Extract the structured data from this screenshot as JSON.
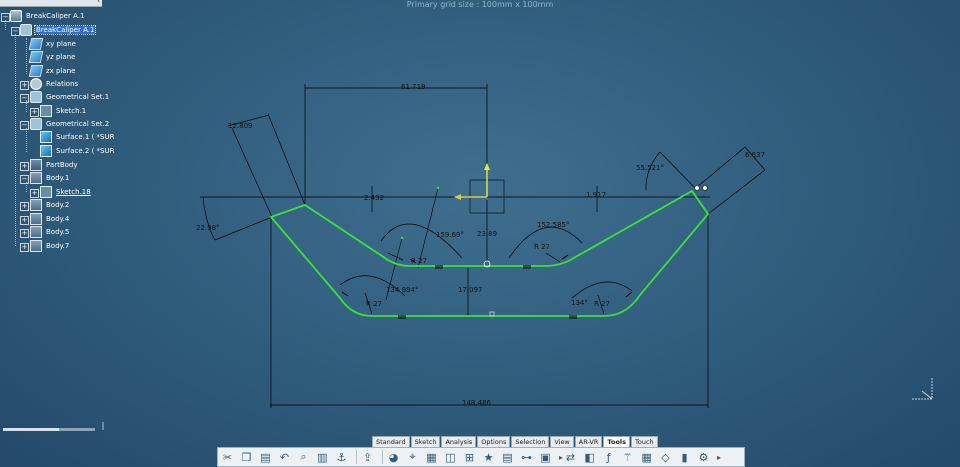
{
  "viewport": {
    "grid_size_label": "Primary grid size : 100mm x 100mm"
  },
  "tree": {
    "root": "BreakCaliper A.1",
    "part": "BreakCaliper A.1",
    "items": [
      {
        "label": "xy plane",
        "icon": "plane-icon"
      },
      {
        "label": "yz plane",
        "icon": "plane-icon"
      },
      {
        "label": "zx plane",
        "icon": "plane-icon"
      },
      {
        "label": "Relations",
        "icon": "relations-icon"
      },
      {
        "label": "Geometrical Set.1",
        "icon": "geometrical-set-icon"
      },
      {
        "label": "Sketch.1",
        "icon": "sketch-icon"
      },
      {
        "label": "Geometrical Set.2",
        "icon": "geometrical-set-icon"
      },
      {
        "label": "Surface.1 ( *SUR",
        "icon": "surface-icon"
      },
      {
        "label": "Surface.2 ( *SUR",
        "icon": "surface-icon"
      },
      {
        "label": "PartBody",
        "icon": "body-icon"
      },
      {
        "label": "Body.1",
        "icon": "body-icon"
      },
      {
        "label": "Sketch.18",
        "icon": "sketch-icon"
      },
      {
        "label": "Body.2",
        "icon": "body-icon"
      },
      {
        "label": "Body.4",
        "icon": "body-icon"
      },
      {
        "label": "Body.5",
        "icon": "body-icon"
      },
      {
        "label": "Body.7",
        "icon": "body-icon"
      }
    ]
  },
  "dimensions": {
    "d_61_719": "61.719",
    "d_12_809": "12.809",
    "d_2_432": "2.432",
    "d_22_98": "22.98°",
    "d_159_69": "159.69°",
    "d_23_89": "23.89",
    "d_152_585": "152.585°",
    "d_55_521": "55.521°",
    "d_6_637": "6.637",
    "d_1_917": "1.917",
    "d_r27_a": "R 27",
    "d_r27_b": "R 27",
    "d_r27_c": "R 27",
    "d_r27_d": "R 27",
    "d_134_984": "134.984°",
    "d_17_097": "17.097",
    "d_134": "134°",
    "d_148_486": "148.486"
  },
  "tabs": [
    "Standard",
    "Sketch",
    "Analysis",
    "Options",
    "Selection",
    "View",
    "AR-VR",
    "Tools",
    "Touch"
  ],
  "active_tab": "Tools",
  "toolbar": [
    "cut-icon",
    "copy-icon",
    "paste-icon",
    "undo-icon",
    "zoom-icon",
    "book-icon",
    "compass-icon",
    "export-icon",
    "sphere-icon",
    "wireframe-icon",
    "grid-icon",
    "multiview-icon",
    "measure-icon",
    "star-icon",
    "sheet-icon",
    "tree-icon",
    "camera-icon",
    "connect-icon",
    "layer-icon",
    "formula-icon",
    "wizard-icon",
    "table-icon",
    "shape-icon",
    "battery-icon",
    "settings-icon"
  ],
  "colors": {
    "background": "#2f5b7b",
    "profile": "#38e23a",
    "selection": "#2b6fd6",
    "axis_v": "#e8e83a",
    "axis_h": "#d6c84a"
  }
}
